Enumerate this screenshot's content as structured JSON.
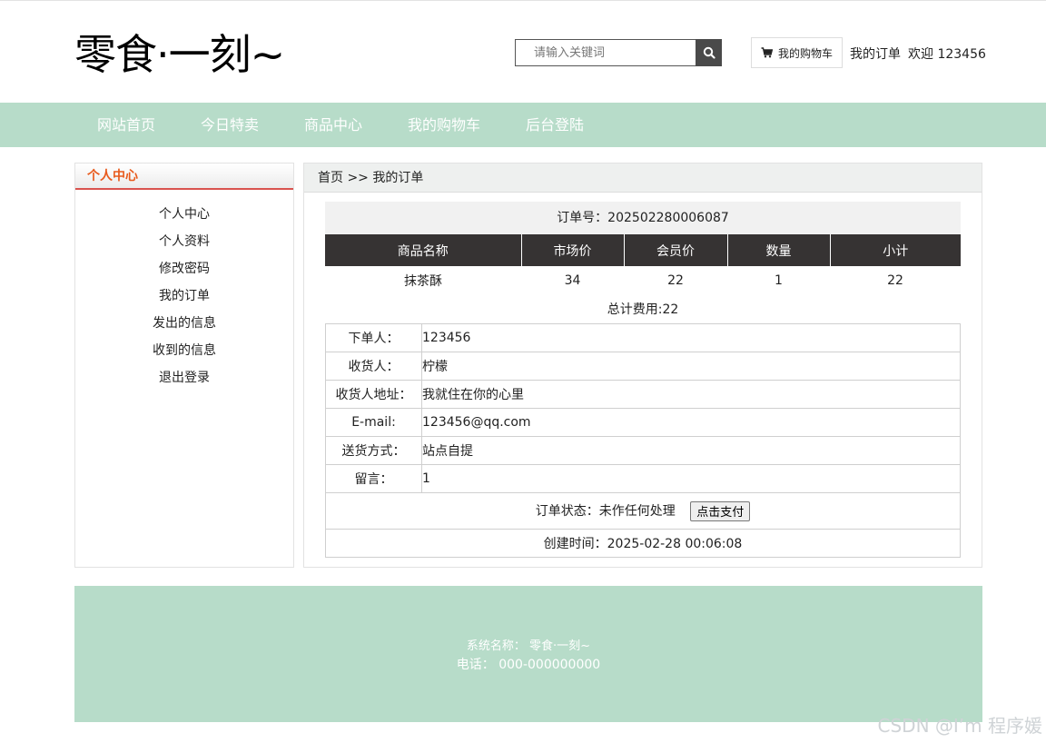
{
  "header": {
    "logo": "零食·一刻~",
    "search_placeholder": "请输入关键词",
    "cart_label": "我的购物车",
    "my_orders": "我的订单",
    "welcome": "欢迎 123456"
  },
  "nav": [
    "网站首页",
    "今日特卖",
    "商品中心",
    "我的购物车",
    "后台登陆"
  ],
  "sidebar": {
    "title": "个人中心",
    "items": [
      "个人中心",
      "个人资料",
      "修改密码",
      "我的订单",
      "发出的信息",
      "收到的信息",
      "退出登录"
    ]
  },
  "main": {
    "breadcrumb": "首页 >> 我的订单",
    "order_no": "订单号：202502280006087",
    "columns": [
      "商品名称",
      "市场价",
      "会员价",
      "数量",
      "小计"
    ],
    "rows": [
      [
        "抹茶酥",
        "34",
        "22",
        "1",
        "22"
      ]
    ],
    "total": "总计费用:22",
    "info": [
      {
        "label": "下单人：",
        "value": "123456"
      },
      {
        "label": "收货人：",
        "value": "柠檬"
      },
      {
        "label": "收货人地址：",
        "value": "我就住在你的心里"
      },
      {
        "label": "E-mail:",
        "value": "123456@qq.com"
      },
      {
        "label": "送货方式：",
        "value": "站点自提"
      },
      {
        "label": "留言：",
        "value": "1"
      }
    ],
    "status": "订单状态：未作任何处理",
    "pay_button": "点击支付",
    "created": "创建时间：2025-02-28 00:06:08"
  },
  "footer": {
    "system_name": "系统名称： 零食·一刻~",
    "phone": "电话： 000-000000000"
  },
  "watermark": "CSDN @I’m 程序媛"
}
